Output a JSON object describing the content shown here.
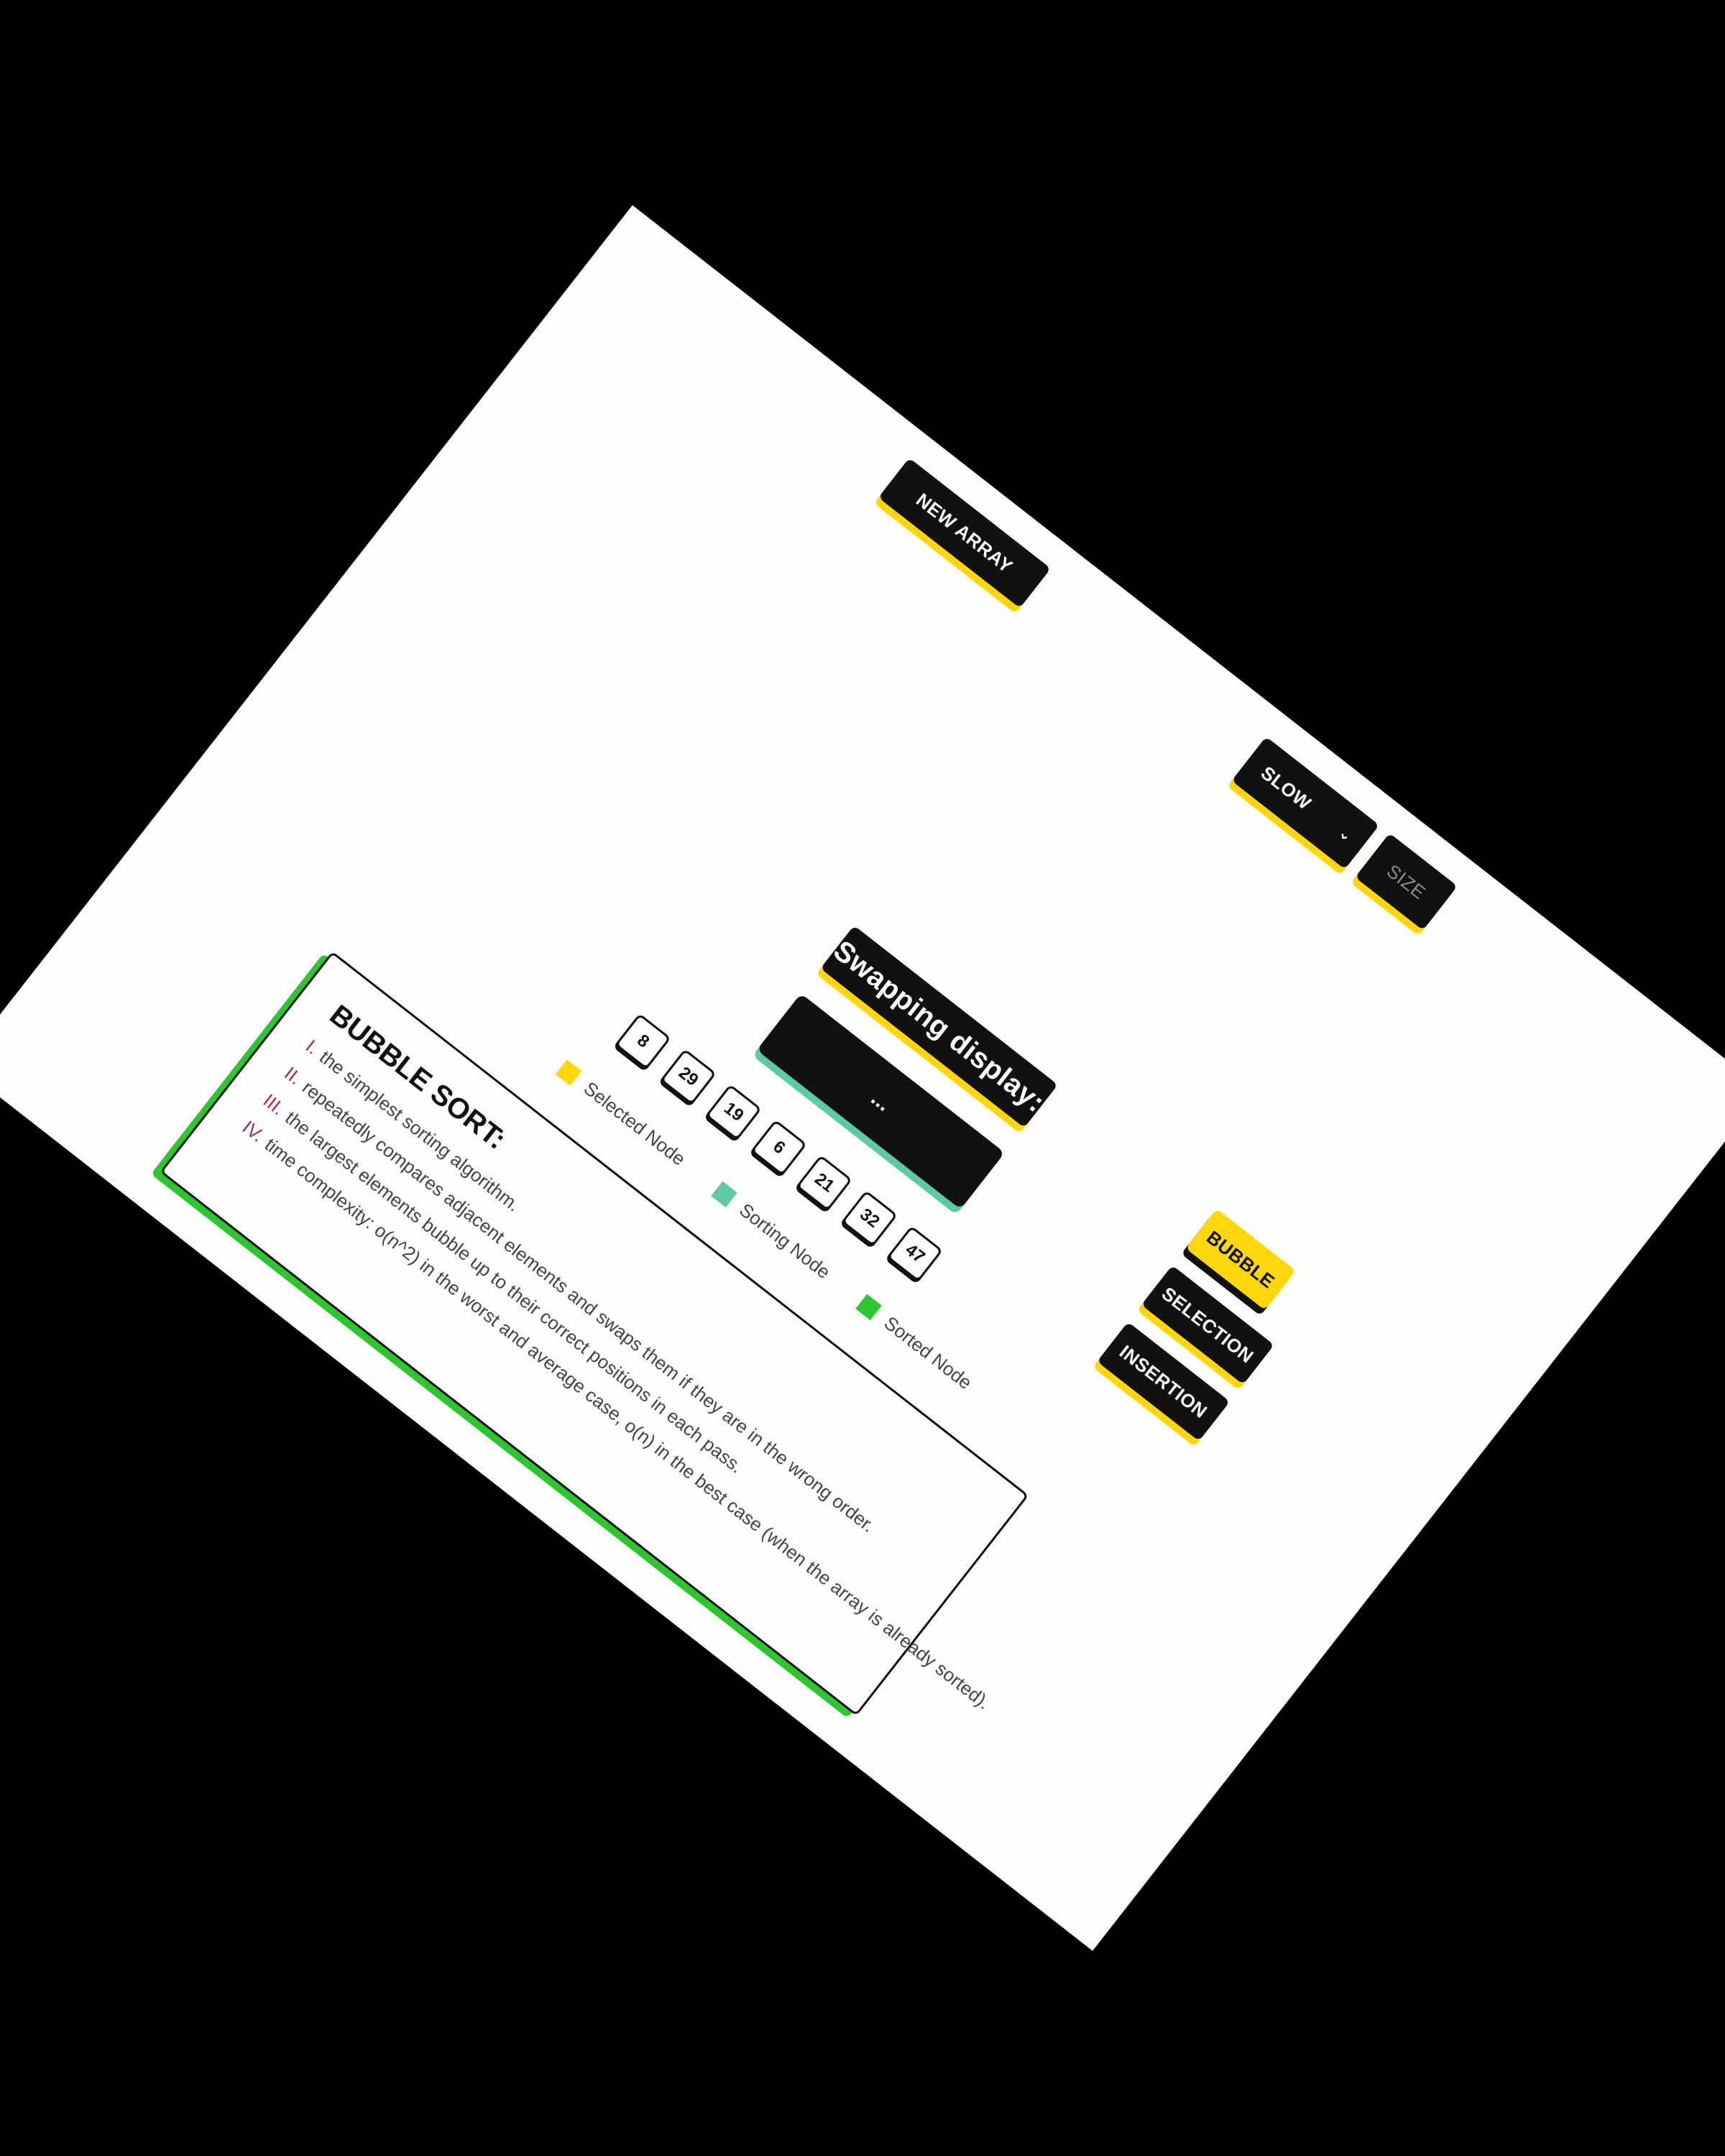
{
  "toolbar": {
    "new_array_label": "NEW ARRAY",
    "speed_value": "SLOW",
    "size_placeholder": "SIZE"
  },
  "algorithms": {
    "bubble": "BUBBLE",
    "selection": "SELECTION",
    "insertion": "INSERTION",
    "active": "bubble"
  },
  "swap_display": {
    "title": "Swapping display:",
    "content": "..."
  },
  "array": [
    8,
    29,
    19,
    6,
    21,
    32,
    47
  ],
  "legend": {
    "selected": {
      "label": "Selected Node",
      "color": "#ffd60a"
    },
    "sorting": {
      "label": "Sorting Node",
      "color": "#5ec9a6"
    },
    "sorted": {
      "label": "Sorted Node",
      "color": "#2dc631"
    }
  },
  "info": {
    "title": "BUBBLE SORT:",
    "lines": [
      {
        "numeral": "I.",
        "text": "the simplest sorting algorithm."
      },
      {
        "numeral": "II.",
        "text": "repeatedly compares adjacent elements and swaps them if they are in the wrong order."
      },
      {
        "numeral": "III.",
        "text": "the largest elements bubble up to their correct positions in each pass."
      },
      {
        "numeral": "IV.",
        "text": "time complexity: o(n^2) in the worst and average case, o(n) in the best case (when the array is already sorted)."
      }
    ]
  }
}
